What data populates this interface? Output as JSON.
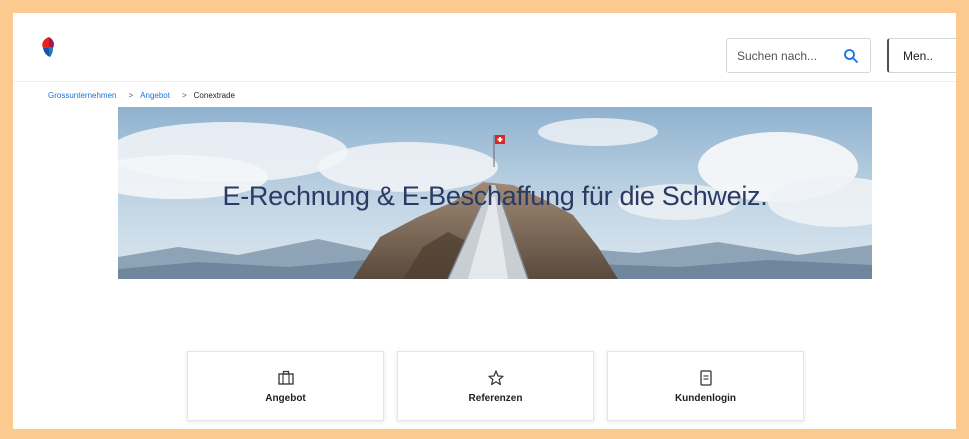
{
  "header": {
    "search_placeholder": "Suchen nach...",
    "menu_label": "Men.."
  },
  "breadcrumb": {
    "items": [
      "Grossunternehmen",
      "Angebot",
      "Conextrade"
    ]
  },
  "hero": {
    "title": "E-Rechnung & E-Beschaffung für die Schweiz."
  },
  "tiles": [
    {
      "label": "Angebot",
      "icon": "briefcase-icon"
    },
    {
      "label": "Referenzen",
      "icon": "star-icon"
    },
    {
      "label": "Kundenlogin",
      "icon": "document-icon"
    }
  ],
  "colors": {
    "frame": "#fcc98e",
    "link": "#1a73d9",
    "title": "#2b3a64",
    "brand_red": "#e2261c",
    "brand_blue": "#1f4fa3"
  }
}
